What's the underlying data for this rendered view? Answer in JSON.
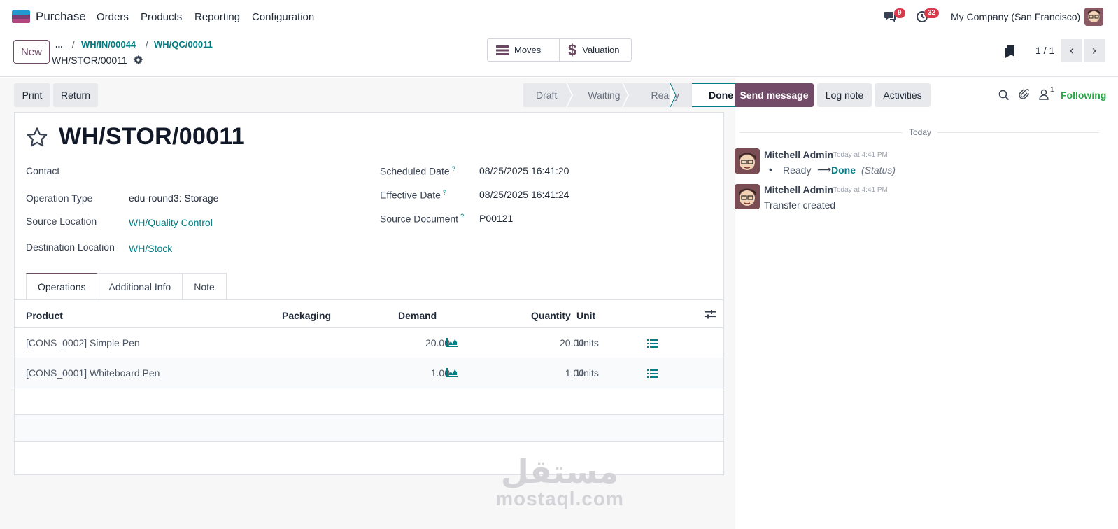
{
  "topbar": {
    "app_name": "Purchase",
    "menus": [
      "Orders",
      "Products",
      "Reporting",
      "Configuration"
    ],
    "messages_count": "9",
    "activities_count": "32",
    "company": "My Company (San Francisco)"
  },
  "control_panel": {
    "new_label": "New",
    "breadcrumb_more": "...",
    "breadcrumbs": [
      "WH/IN/00044",
      "WH/QC/00011"
    ],
    "breadcrumb_sep": "/",
    "current": "WH/STOR/00011",
    "smart_buttons": [
      "Moves",
      "Valuation"
    ],
    "pager": "1 / 1"
  },
  "actions": {
    "print": "Print",
    "return": "Return"
  },
  "statusbar": {
    "stages": [
      "Draft",
      "Waiting",
      "Ready",
      "Done"
    ],
    "active": "Done"
  },
  "form": {
    "title": "WH/STOR/00011",
    "contact_label": "Contact",
    "operation_type_label": "Operation Type",
    "operation_type": "edu-round3: Storage",
    "source_location_label": "Source Location",
    "source_location": "WH/Quality Control",
    "destination_location_label": "Destination Location",
    "destination_location": "WH/Stock",
    "scheduled_date_label": "Scheduled Date",
    "scheduled_date": "08/25/2025 16:41:20",
    "effective_date_label": "Effective Date",
    "effective_date": "08/25/2025 16:41:24",
    "source_document_label": "Source Document",
    "source_document": "P00121",
    "help_mark": "?"
  },
  "tabs": [
    "Operations",
    "Additional Info",
    "Note"
  ],
  "operations": {
    "headers": {
      "product": "Product",
      "packaging": "Packaging",
      "demand": "Demand",
      "quantity": "Quantity",
      "unit": "Unit"
    },
    "rows": [
      {
        "product": "[CONS_0002] Simple Pen",
        "demand": "20.00",
        "quantity": "20.00",
        "unit": "Units"
      },
      {
        "product": "[CONS_0001] Whiteboard Pen",
        "demand": "1.00",
        "quantity": "1.00",
        "unit": "Units"
      }
    ]
  },
  "chatter": {
    "send_message": "Send message",
    "log_note": "Log note",
    "activities": "Activities",
    "followers_count": "1",
    "following": "Following",
    "date_separator": "Today",
    "messages": [
      {
        "author": "Mitchell Admin",
        "time": "Today at 4:41 PM",
        "old_value": "Ready",
        "arrow": "⟶",
        "new_value": "Done",
        "field": "(Status)"
      },
      {
        "author": "Mitchell Admin",
        "time": "Today at 4:41 PM",
        "body": "Transfer created"
      }
    ]
  },
  "watermark": {
    "arabic": "مستقل",
    "latin": "mostaql.com"
  },
  "colors": {
    "brand": "#714b67",
    "link": "#017e84",
    "badge": "#d93a4b"
  }
}
